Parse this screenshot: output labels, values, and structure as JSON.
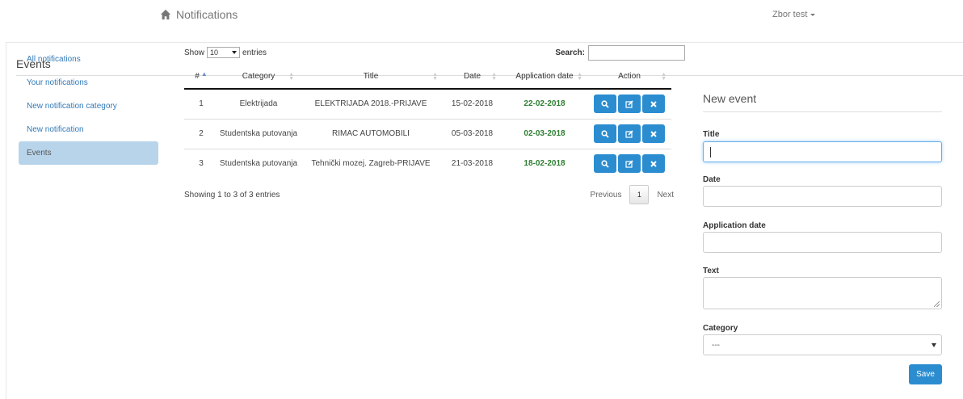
{
  "navbar": {
    "brand_label": "Notifications",
    "user_name": "Zbor test"
  },
  "panel": {
    "title": "Events"
  },
  "sidebar": {
    "items": [
      {
        "label": "All notifications"
      },
      {
        "label": "Your notifications"
      },
      {
        "label": "New notification category"
      },
      {
        "label": "New notification"
      },
      {
        "label": "Events",
        "active": true
      }
    ]
  },
  "table_controls": {
    "show_label": "Show",
    "entries_value": "10",
    "entries_label": "entries",
    "search_label": "Search:",
    "search_value": ""
  },
  "table": {
    "headers": [
      "#",
      "Category",
      "Title",
      "Date",
      "Application date",
      "Action"
    ],
    "rows": [
      {
        "num": "1",
        "category": "Elektrijada",
        "title": "ELEKTRIJADA 2018.-PRIJAVE",
        "date": "15-02-2018",
        "app_date": "22-02-2018"
      },
      {
        "num": "2",
        "category": "Studentska putovanja",
        "title": "RIMAC AUTOMOBILI",
        "date": "05-03-2018",
        "app_date": "02-03-2018"
      },
      {
        "num": "3",
        "category": "Studentska putovanja",
        "title": "Tehnički mozej. Zagreb-PRIJAVE",
        "date": "21-03-2018",
        "app_date": "18-02-2018"
      }
    ],
    "info": "Showing 1 to 3 of 3 entries",
    "pager": {
      "previous": "Previous",
      "current_page": "1",
      "next": "Next"
    }
  },
  "form": {
    "title": "New event",
    "title_label": "Title",
    "title_value": "",
    "date_label": "Date",
    "date_value": "",
    "app_date_label": "Application date",
    "app_date_value": "",
    "text_label": "Text",
    "text_value": "",
    "category_label": "Category",
    "category_value": "---",
    "save_label": "Save"
  },
  "colors": {
    "primary": "#2b8dd0",
    "active_bg": "#b8d4ea",
    "link": "#337ab7",
    "app_date_green": "#2e7d32"
  }
}
